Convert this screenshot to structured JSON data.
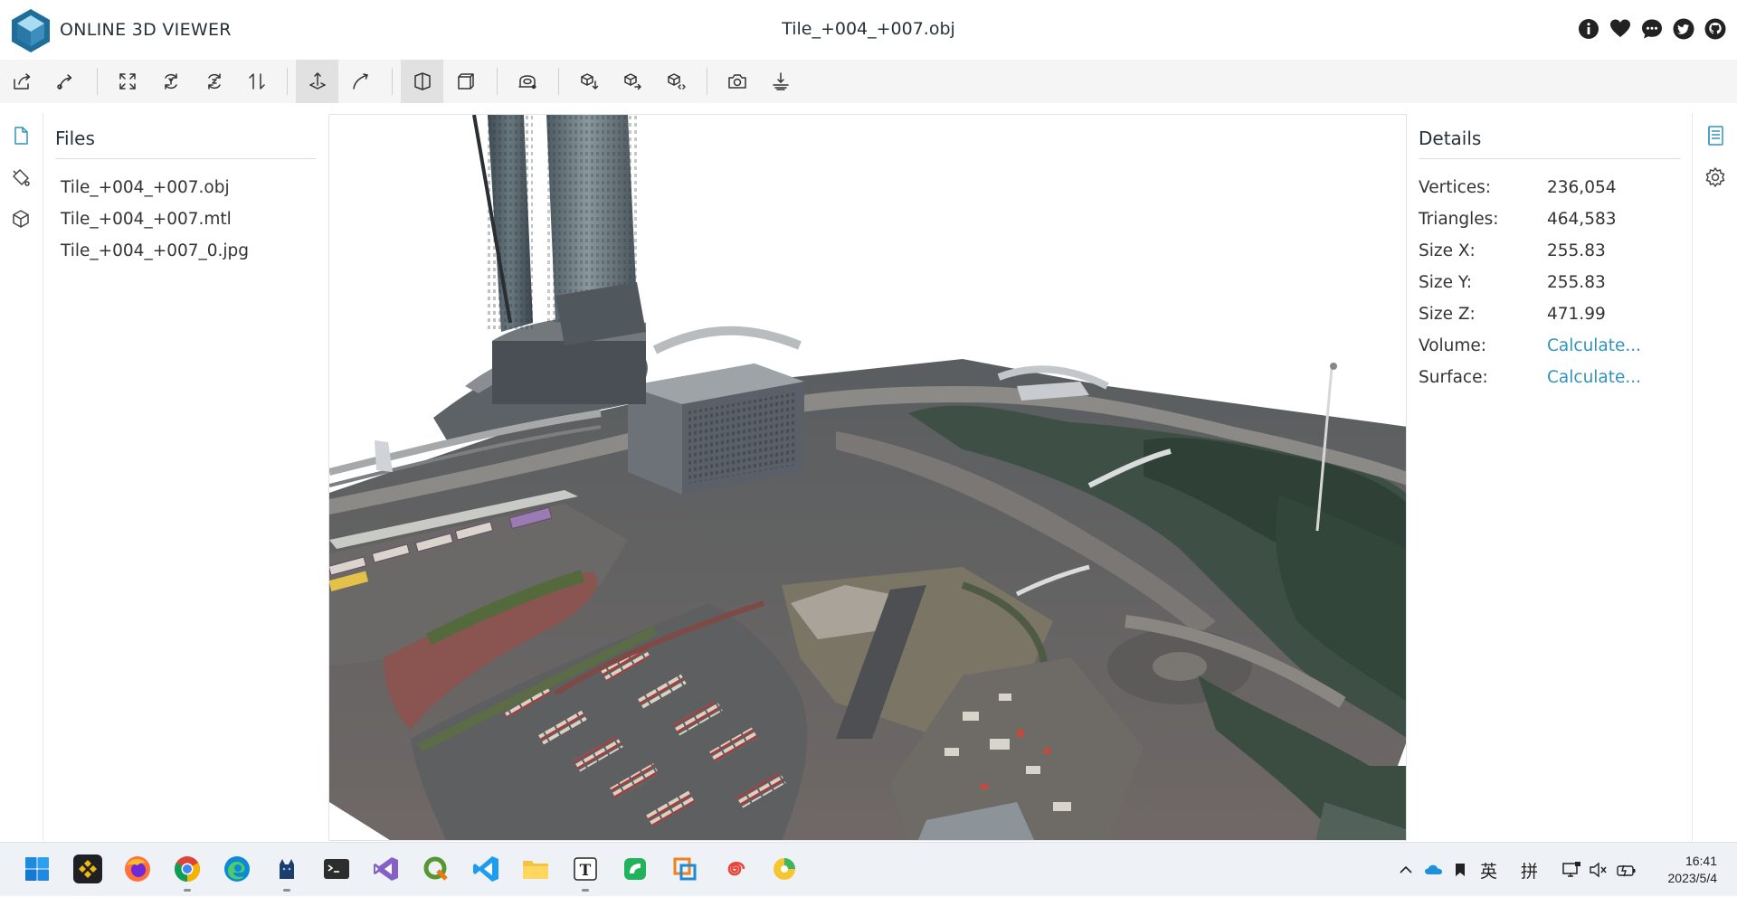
{
  "header": {
    "app_title": "ONLINE 3D VIEWER",
    "file_title": "Tile_+004_+007.obj",
    "icons": [
      "info-icon",
      "heart-icon",
      "chat-icon",
      "twitter-icon",
      "github-icon"
    ]
  },
  "toolbar": {
    "buttons": [
      "open-file",
      "open-url",
      "fit-to-window",
      "set-up-y",
      "set-up-z",
      "flip-up",
      "orbit-navigation",
      "free-navigation",
      "perspective-camera",
      "orthographic-camera",
      "measure",
      "export",
      "share",
      "snapshot",
      "settings"
    ],
    "active": [
      "orbit-navigation",
      "perspective-camera"
    ]
  },
  "files_panel": {
    "title": "Files",
    "items": [
      "Tile_+004_+007.obj",
      "Tile_+004_+007.mtl",
      "Tile_+004_+007_0.jpg"
    ]
  },
  "details_panel": {
    "title": "Details",
    "rows": [
      {
        "key": "Vertices:",
        "value": "236,054"
      },
      {
        "key": "Triangles:",
        "value": "464,583"
      },
      {
        "key": "Size X:",
        "value": "255.83"
      },
      {
        "key": "Size Y:",
        "value": "255.83"
      },
      {
        "key": "Size Z:",
        "value": "471.99"
      },
      {
        "key": "Volume:",
        "value": "Calculate..."
      },
      {
        "key": "Surface:",
        "value": "Calculate..."
      }
    ]
  },
  "taskbar": {
    "apps": [
      "start-button",
      "binance-app",
      "firefox-app",
      "chrome-app",
      "edge-app",
      "cat-app",
      "terminal-app",
      "visual-studio-app",
      "qgis-app",
      "vscode-app",
      "file-explorer-app",
      "typora-app",
      "green-app",
      "office-app",
      "spiral-app",
      "photos-app"
    ],
    "ime_lang": "英",
    "ime_mode": "拼",
    "time": "16:41",
    "date": "2023/5/4"
  },
  "colors": {
    "accent": "#3393bd",
    "toolbar_bg": "#f5f5f5",
    "active_btn": "#e1e1e1",
    "logo": "#1f6e99"
  }
}
